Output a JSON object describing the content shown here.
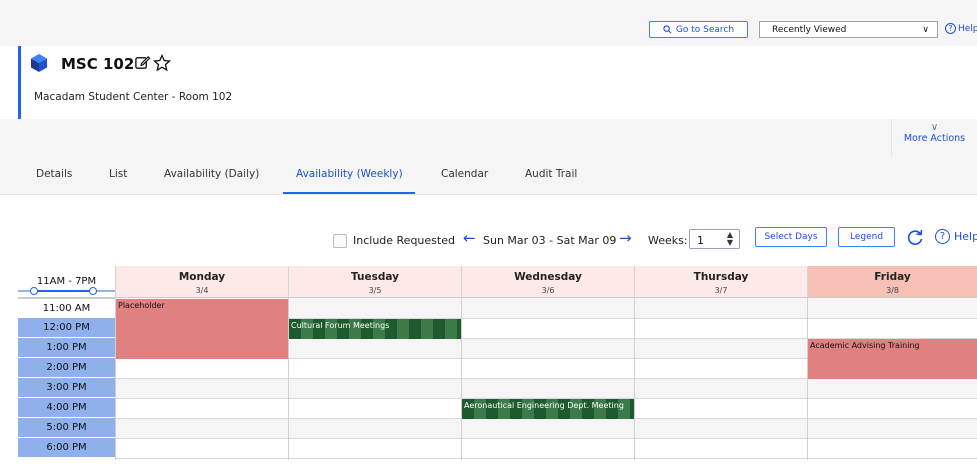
{
  "topbar": {
    "search_label": "Go to Search",
    "recently_viewed": "Recently Viewed",
    "help_label": "Help"
  },
  "header": {
    "title": "MSC 102",
    "subtitle": "Macadam Student Center - Room 102"
  },
  "more_actions": "More Actions",
  "tabs": [
    "Details",
    "List",
    "Availability (Daily)",
    "Availability (Weekly)",
    "Calendar",
    "Audit Trail"
  ],
  "active_tab": "Availability (Weekly)",
  "toolbar": {
    "include_requested": "Include Requested",
    "include_requested_checked": false,
    "date_range": "Sun Mar 03 - Sat Mar 09",
    "weeks_label": "Weeks:",
    "weeks_value": "1",
    "select_days": "Select Days",
    "legend": "Legend",
    "help_label": "Help"
  },
  "time_range_label": "11AM - 7PM",
  "days": [
    {
      "name": "Monday",
      "date": "3/4"
    },
    {
      "name": "Tuesday",
      "date": "3/5"
    },
    {
      "name": "Wednesday",
      "date": "3/6"
    },
    {
      "name": "Thursday",
      "date": "3/7"
    },
    {
      "name": "Friday",
      "date": "3/8"
    }
  ],
  "times": [
    "11:00 AM",
    "12:00 PM",
    "1:00 PM",
    "2:00 PM",
    "3:00 PM",
    "4:00 PM",
    "5:00 PM",
    "6:00 PM"
  ],
  "events": [
    {
      "label": "Placeholder",
      "day": "Monday",
      "start": "11:00 AM",
      "end": "2:00 PM",
      "style": "reserved"
    },
    {
      "label": "Cultural Forum Meetings",
      "day": "Tuesday",
      "start": "12:00 PM",
      "end": "1:00 PM",
      "style": "pending"
    },
    {
      "label": "Academic Advising Training",
      "day": "Friday",
      "start": "1:00 PM",
      "end": "3:00 PM",
      "style": "reserved"
    },
    {
      "label": "Aeronautical Engineering Dept. Meeting",
      "day": "Wednesday",
      "start": "4:00 PM",
      "end": "5:00 PM",
      "style": "pending"
    }
  ],
  "colors": {
    "accent": "#2563eb",
    "day_header": "#fde9e7",
    "friday_header": "#f5c1b6",
    "time_highlight": "#8fb0ea",
    "event_reserved": "#e08080",
    "event_pending": "#1f5a2e"
  }
}
